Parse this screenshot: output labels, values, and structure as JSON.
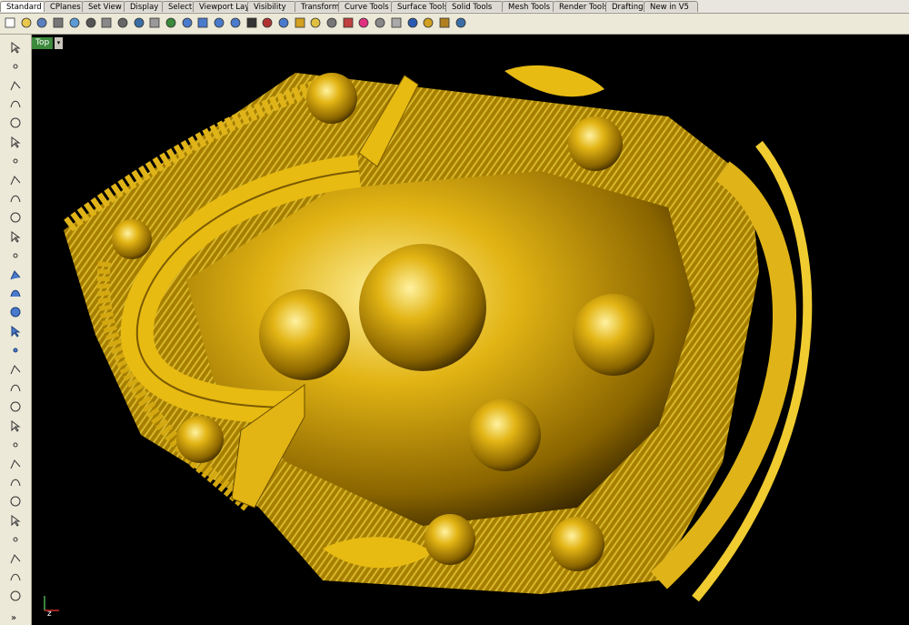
{
  "tabs": [
    "Standard",
    "CPlanes",
    "Set View",
    "Display",
    "Select",
    "Viewport Layout",
    "Visibility",
    "Transform",
    "Curve Tools",
    "Surface Tools",
    "Solid Tools",
    "Mesh Tools",
    "Render Tools",
    "Drafting",
    "New in V5"
  ],
  "toolbar_icons": [
    "new-document-icon",
    "open-folder-icon",
    "save-icon",
    "print-icon",
    "import-icon",
    "cut-icon",
    "copy-icon",
    "paste-icon",
    "undo-icon",
    "pan-hand-icon",
    "rotate-view-icon",
    "zoom-dynamic-icon",
    "zoom-window-icon",
    "zoom-extents-icon",
    "zoom-selected-icon",
    "four-viewports-icon",
    "camera-icon",
    "grid-snap-icon",
    "layer-icon",
    "light-bulb-icon",
    "lock-icon",
    "properties-icon",
    "color-wheel-icon",
    "shaded-sphere-icon",
    "rendered-sphere-icon",
    "render-sphere-icon",
    "materials-icon",
    "options-gear-icon",
    "help-icon"
  ],
  "left_icons": [
    "select-arrow-icon",
    "point-icon",
    "polyline-icon",
    "curve-icon",
    "circle-icon",
    "arc-icon",
    "ellipse-icon",
    "rectangle-icon",
    "polygon-icon",
    "fillet-curve-icon",
    "offset-curve-icon",
    "surface-from-curves-icon",
    "extrude-surface-icon",
    "box-solid-icon",
    "sphere-solid-icon",
    "cylinder-solid-icon",
    "mesh-icon",
    "boolean-icon",
    "explode-icon",
    "join-icon",
    "split-icon",
    "move-icon",
    "rotate-icon",
    "text-icon",
    "dimension-icon",
    "group-icon",
    "array-icon",
    "analyze-icon",
    "render-icon",
    "more-tools-icon"
  ],
  "viewport": {
    "name": "Top",
    "axis_label": "z"
  },
  "more_label": "»",
  "colors": {
    "model_gold": "#c99a00",
    "viewport_bg": "#000000",
    "viewport_tab": "#3c8a3c"
  }
}
